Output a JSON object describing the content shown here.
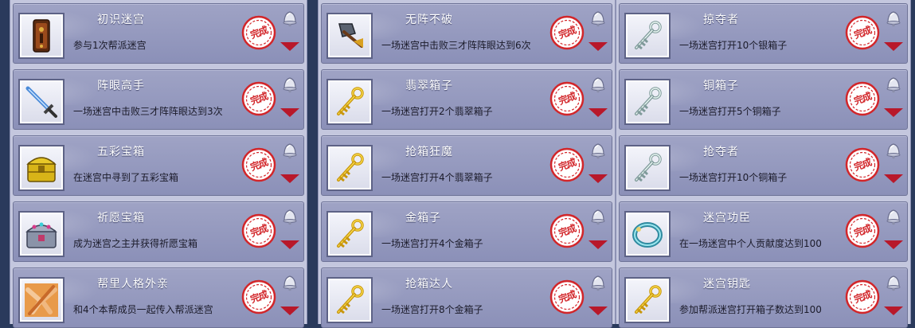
{
  "seal_text": "完成",
  "columns": [
    {
      "cards": [
        {
          "title": "初识迷宫",
          "desc": "参与1次帮派迷宫",
          "icon": "door-icon"
        },
        {
          "title": "阵眼高手",
          "desc": "一场迷宫中击败三才阵阵眼达到3次",
          "icon": "sword-icon"
        },
        {
          "title": "五彩宝箱",
          "desc": "在迷宫中寻到了五彩宝箱",
          "icon": "treasure-chest-icon"
        },
        {
          "title": "祈愿宝箱",
          "desc": "成为迷宫之主并获得祈愿宝箱",
          "icon": "jeweled-chest-icon"
        },
        {
          "title": "帮里人格外亲",
          "desc": "和4个本帮成员一起传入帮派迷宫",
          "icon": "joined-hands-icon"
        }
      ]
    },
    {
      "cards": [
        {
          "title": "无阵不破",
          "desc": "一场迷宫中击败三才阵阵眼达到6次",
          "icon": "axe-icon"
        },
        {
          "title": "翡翠箱子",
          "desc": "一场迷宫打开2个翡翠箱子",
          "icon": "gold-key-icon"
        },
        {
          "title": "抢箱狂魔",
          "desc": "一场迷宫打开4个翡翠箱子",
          "icon": "gold-key-icon"
        },
        {
          "title": "金箱子",
          "desc": "一场迷宫打开4个金箱子",
          "icon": "gold-key-icon"
        },
        {
          "title": "抢箱达人",
          "desc": "一场迷宫打开8个金箱子",
          "icon": "gold-key-icon"
        }
      ]
    },
    {
      "cards": [
        {
          "title": "掠夺者",
          "desc": "一场迷宫打开10个银箱子",
          "icon": "silver-key-icon"
        },
        {
          "title": "铜箱子",
          "desc": "一场迷宫打开5个铜箱子",
          "icon": "silver-key-icon"
        },
        {
          "title": "抢夺者",
          "desc": "一场迷宫打开10个铜箱子",
          "icon": "silver-key-icon"
        },
        {
          "title": "迷宫功臣",
          "desc": "在一场迷宫中个人贡献度达到100",
          "icon": "jade-ring-icon"
        },
        {
          "title": "迷宫钥匙",
          "desc": "参加帮派迷宫打开箱子数达到100",
          "icon": "gold-key-icon"
        }
      ]
    }
  ],
  "colors": {
    "panel": "#c4c7de",
    "card": "#959ac0",
    "seal_red": "#d2262a",
    "expand_arrow": "#b8182a",
    "title_text": "#ffffff",
    "desc_text": "#1b1b2a"
  }
}
